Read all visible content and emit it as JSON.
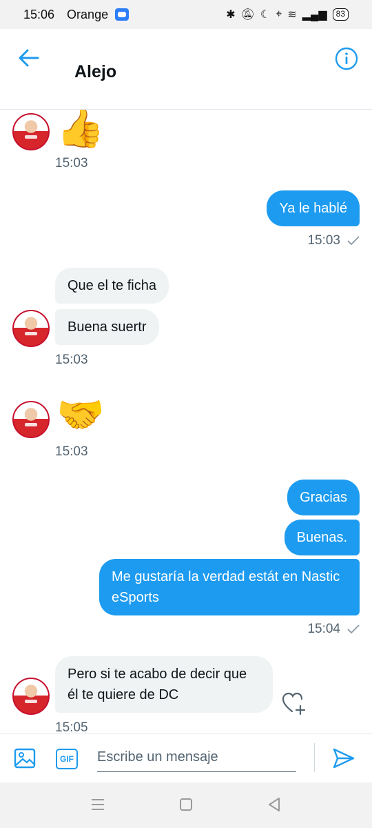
{
  "status_bar": {
    "time": "15:06",
    "carrier": "Orange",
    "battery": "83"
  },
  "header": {
    "title": "Alejo"
  },
  "messages": [
    {
      "type": "emoji",
      "from": "other",
      "emoji": "👍",
      "time": "15:03"
    },
    {
      "type": "text",
      "from": "me",
      "text": "Ya le hablé",
      "time": "15:03"
    },
    {
      "type": "text",
      "from": "other",
      "text": "Que el te ficha"
    },
    {
      "type": "text",
      "from": "other",
      "text": "Buena suertr",
      "time": "15:03"
    },
    {
      "type": "emoji",
      "from": "other",
      "emoji": "🤝",
      "time": "15:03"
    },
    {
      "type": "text",
      "from": "me",
      "text": "Gracias"
    },
    {
      "type": "text",
      "from": "me",
      "text": "Buenas."
    },
    {
      "type": "text",
      "from": "me",
      "text": "Me gustaría la verdad estát en Nastic eSports",
      "time": "15:04"
    },
    {
      "type": "text",
      "from": "other",
      "text": "Pero si te acabo de decir que él te quiere de DC",
      "time": "15:05"
    }
  ],
  "composer": {
    "placeholder": "Escribe un mensaje",
    "gif_label": "GIF"
  },
  "colors": {
    "accent": "#1d9bf0",
    "incoming_bubble": "#eff3f4",
    "timestamp": "#536471"
  },
  "icons": [
    "back-arrow-icon",
    "info-icon",
    "image-icon",
    "gif-icon",
    "send-icon",
    "heart-plus-icon",
    "read-check-icon"
  ]
}
